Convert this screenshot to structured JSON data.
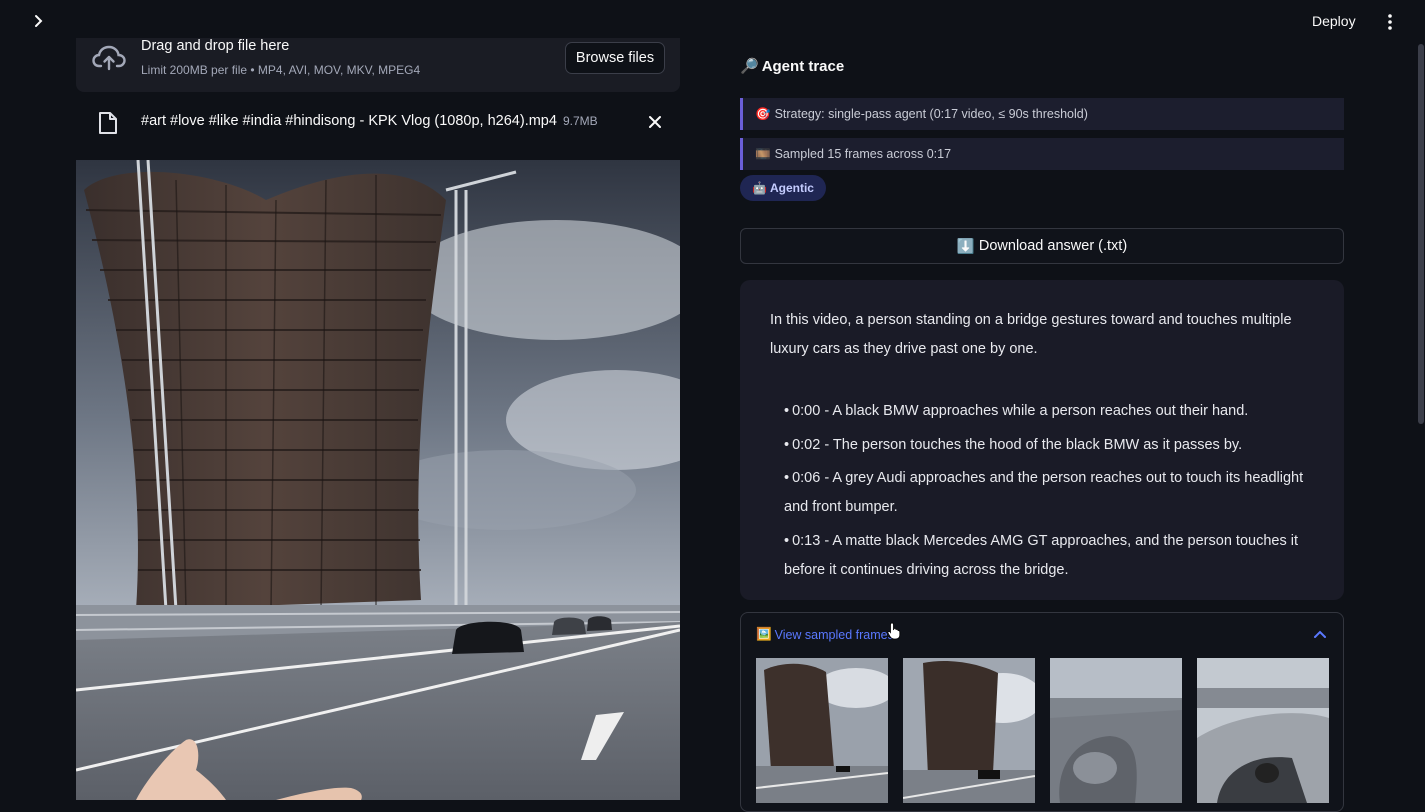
{
  "header": {
    "deploy_label": "Deploy"
  },
  "uploader": {
    "title": "Drag and drop file here",
    "limit": "Limit 200MB per file • MP4, AVI, MOV, MKV, MPEG4",
    "browse_label": "Browse files",
    "file_name": "#art #love #like #india #hindisong - KPK Vlog (1080p, h264).mp4",
    "file_size": "9.7MB"
  },
  "agent": {
    "title_icon": "🔎",
    "title": "Agent trace",
    "trace": [
      {
        "icon": "🎯",
        "text": "Strategy: single-pass agent (0:17 video, ≤ 90s threshold)"
      },
      {
        "icon": "🎞️",
        "text": "Sampled 15 frames across 0:17"
      }
    ],
    "badge_icon": "🤖",
    "badge": "Agentic"
  },
  "download": {
    "icon": "⬇️",
    "label": "Download answer (.txt)"
  },
  "answer": {
    "intro": "In this video, a person standing on a bridge gestures toward and touches multiple luxury cars as they drive past one by one.",
    "items": [
      "0:00 - A black BMW approaches while a person reaches out their hand.",
      "0:02 - The person touches the hood of the black BMW as it passes by.",
      "0:06 - A grey Audi approaches and the person reaches out to touch its headlight and front bumper.",
      "0:13 - A matte black Mercedes AMG GT approaches, and the person touches it before it continues driving across the bridge."
    ]
  },
  "frames": {
    "icon": "🖼️",
    "label": "View sampled frames"
  },
  "colors": {
    "background": "#0e1117",
    "accent_link": "#5a78ff",
    "trace_border": "#6b5fd8",
    "badge_bg": "#1f2653"
  }
}
